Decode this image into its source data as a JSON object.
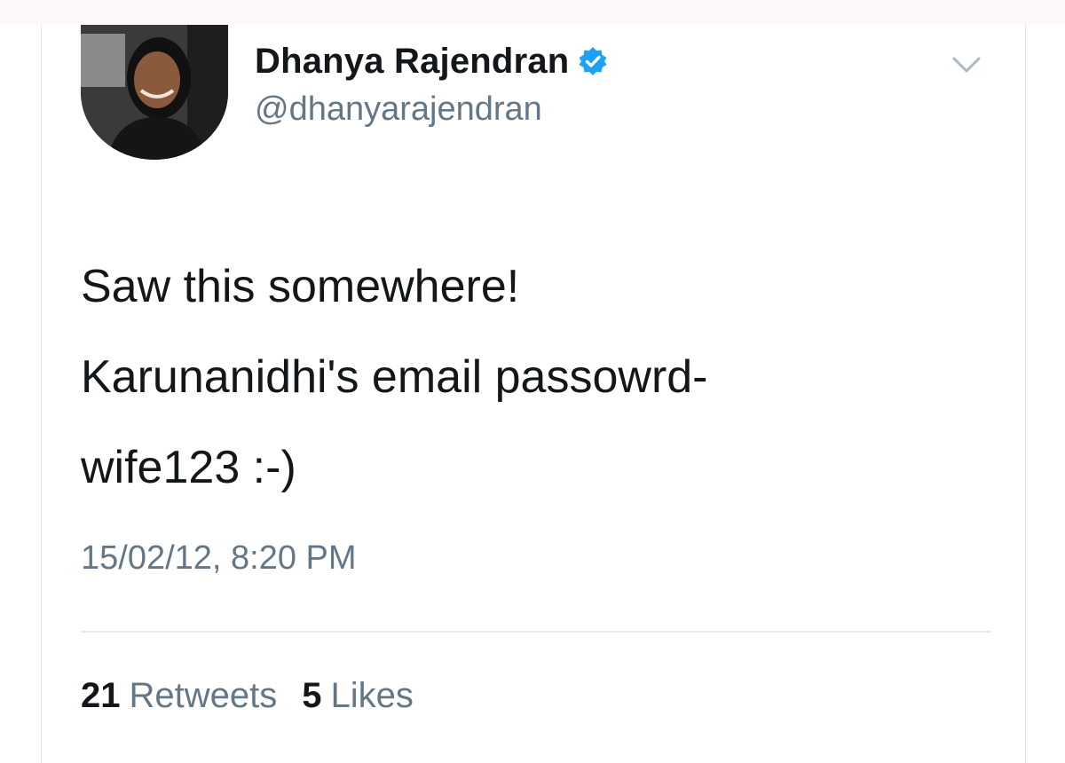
{
  "tweet": {
    "author_name": "Dhanya Rajendran",
    "author_handle": "@dhanyarajendran",
    "verified": true,
    "text_lines": [
      "Saw this somewhere!",
      "Karunanidhi's email passowrd-",
      "wife123 :-)"
    ],
    "timestamp": "15/02/12, 8:20 PM",
    "stats": {
      "retweets_count": "21",
      "retweets_label": "Retweets",
      "likes_count": "5",
      "likes_label": "Likes"
    }
  },
  "icons": {
    "verified": "verified-badge-icon",
    "caret": "chevron-down-icon"
  },
  "colors": {
    "verified_blue": "#1da1f2",
    "text_primary": "#14171a",
    "text_secondary": "#657786",
    "divider": "#e6ecf0"
  }
}
